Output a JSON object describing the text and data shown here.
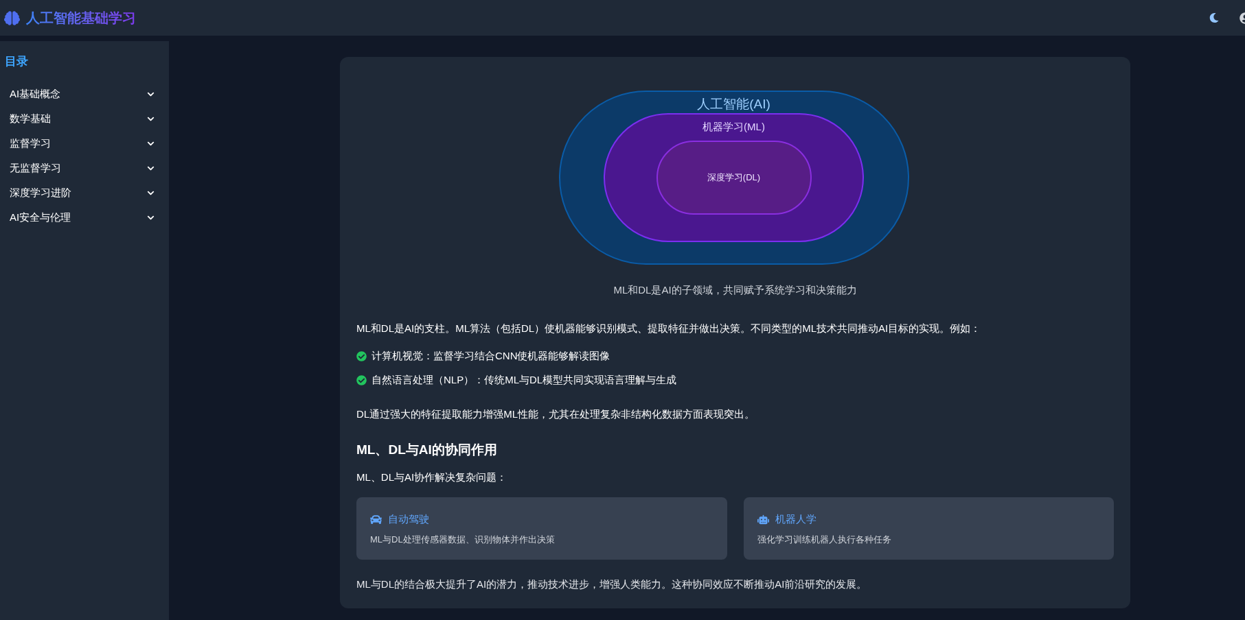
{
  "header": {
    "title": "人工智能基础学习"
  },
  "sidebar": {
    "title": "目录",
    "items": [
      {
        "label": "AI基础概念",
        "expanded": false
      },
      {
        "label": "数学基础",
        "expanded": false
      },
      {
        "label": "监督学习",
        "expanded": false
      },
      {
        "label": "无监督学习",
        "expanded": false
      },
      {
        "label": "深度学习进阶",
        "expanded": false
      },
      {
        "label": "AI安全与伦理",
        "expanded": false
      }
    ]
  },
  "diagram": {
    "label": "人工智能(AI)",
    "children": [
      {
        "label": "机器学习(ML)",
        "children": [
          {
            "label": "深度学习(DL)"
          }
        ]
      }
    ]
  },
  "caption": "ML和DL是AI的子领域，共同赋予系统学习和决策能力",
  "intro": "ML和DL是AI的支柱。ML算法（包括DL）使机器能够识别模式、提取特征并做出决策。不同类型的ML技术共同推动AI目标的实现。例如：",
  "examples": [
    "计算机视觉：监督学习结合CNN使机器能够解读图像",
    "自然语言处理（NLP）：传统ML与DL模型共同实现语言理解与生成"
  ],
  "note": "DL通过强大的特征提取能力增强ML性能，尤其在处理复杂非结构化数据方面表现突出。",
  "section": {
    "heading": "ML、DL与AI的协同作用",
    "lead": "ML、DL与AI协作解决复杂问题：",
    "cards": [
      {
        "kind": "car",
        "title": "自动驾驶",
        "text": "ML与DL处理传感器数据、识别物体并作出决策"
      },
      {
        "kind": "robot",
        "title": "机器人学",
        "text": "强化学习训练机器人执行各种任务"
      }
    ]
  },
  "closing": "ML与DL的结合极大提升了AI的潜力，推动技术进步，增强人类能力。这种协同效应不断推动AI前沿研究的发展。"
}
